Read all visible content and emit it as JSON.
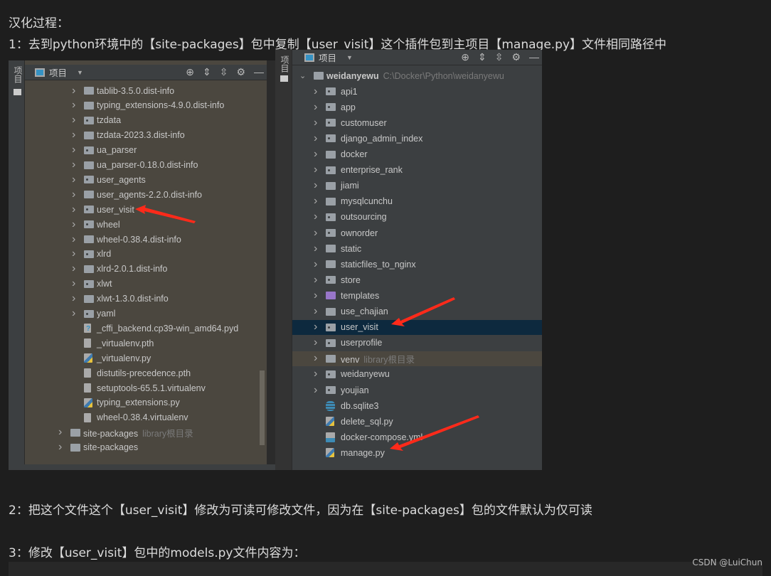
{
  "article": {
    "heading": "汉化过程：",
    "step1": "1：去到python环境中的【site-packages】包中复制【user_visit】这个插件包到主项目【manage.py】文件相同路径中",
    "step2": "2：把这个文件这个【user_visit】修改为可读可修改文件，因为在【site-packages】包的文件默认为仅可读",
    "step3": "3：修改【user_visit】包中的models.py文件内容为：",
    "watermark": "CSDN @LuiChun"
  },
  "left_shot": {
    "strip_label": "项目",
    "panel_title": "项目",
    "items": [
      {
        "label": "tablib-3.5.0.dist-info",
        "icon": "folder",
        "level": 2,
        "expand": true
      },
      {
        "label": "typing_extensions-4.9.0.dist-info",
        "icon": "folder",
        "level": 2,
        "expand": true
      },
      {
        "label": "tzdata",
        "icon": "pkg",
        "level": 2,
        "expand": true
      },
      {
        "label": "tzdata-2023.3.dist-info",
        "icon": "folder",
        "level": 2,
        "expand": true
      },
      {
        "label": "ua_parser",
        "icon": "pkg",
        "level": 2,
        "expand": true
      },
      {
        "label": "ua_parser-0.18.0.dist-info",
        "icon": "folder",
        "level": 2,
        "expand": true
      },
      {
        "label": "user_agents",
        "icon": "pkg",
        "level": 2,
        "expand": true
      },
      {
        "label": "user_agents-2.2.0.dist-info",
        "icon": "folder",
        "level": 2,
        "expand": true
      },
      {
        "label": "user_visit",
        "icon": "pkg",
        "level": 2,
        "expand": true
      },
      {
        "label": "wheel",
        "icon": "pkg",
        "level": 2,
        "expand": true
      },
      {
        "label": "wheel-0.38.4.dist-info",
        "icon": "folder",
        "level": 2,
        "expand": true
      },
      {
        "label": "xlrd",
        "icon": "pkg",
        "level": 2,
        "expand": true
      },
      {
        "label": "xlrd-2.0.1.dist-info",
        "icon": "folder",
        "level": 2,
        "expand": true
      },
      {
        "label": "xlwt",
        "icon": "pkg",
        "level": 2,
        "expand": true
      },
      {
        "label": "xlwt-1.3.0.dist-info",
        "icon": "folder",
        "level": 2,
        "expand": true
      },
      {
        "label": "yaml",
        "icon": "pkg",
        "level": 2,
        "expand": true
      },
      {
        "label": "_cffi_backend.cp39-win_amd64.pyd",
        "icon": "unk",
        "level": 2,
        "expand": false
      },
      {
        "label": "_virtualenv.pth",
        "icon": "file",
        "level": 2,
        "expand": false
      },
      {
        "label": "_virtualenv.py",
        "icon": "py",
        "level": 2,
        "expand": false
      },
      {
        "label": "distutils-precedence.pth",
        "icon": "file",
        "level": 2,
        "expand": false
      },
      {
        "label": "setuptools-65.5.1.virtualenv",
        "icon": "file",
        "level": 2,
        "expand": false
      },
      {
        "label": "typing_extensions.py",
        "icon": "py",
        "level": 2,
        "expand": false
      },
      {
        "label": "wheel-0.38.4.virtualenv",
        "icon": "file",
        "level": 2,
        "expand": false
      },
      {
        "label": "site-packages",
        "hint": "library根目录",
        "icon": "folder",
        "level": 1,
        "expand": true
      },
      {
        "label": "site-packages",
        "icon": "folder",
        "level": 1,
        "expand": true
      }
    ]
  },
  "right_shot": {
    "strip_label": "项目",
    "panel_title": "项目",
    "root": {
      "label": "weidanyewu",
      "path": "C:\\Docker\\Python\\weidanyewu"
    },
    "items": [
      {
        "label": "api1",
        "icon": "pkg",
        "expand": true
      },
      {
        "label": "app",
        "icon": "pkg",
        "expand": true
      },
      {
        "label": "customuser",
        "icon": "pkg",
        "expand": true
      },
      {
        "label": "django_admin_index",
        "icon": "pkg",
        "expand": true
      },
      {
        "label": "docker",
        "icon": "folder",
        "expand": true
      },
      {
        "label": "enterprise_rank",
        "icon": "pkg",
        "expand": true
      },
      {
        "label": "jiami",
        "icon": "folder",
        "expand": true
      },
      {
        "label": "mysqlcunchu",
        "icon": "folder",
        "expand": true
      },
      {
        "label": "outsourcing",
        "icon": "pkg",
        "expand": true
      },
      {
        "label": "ownorder",
        "icon": "pkg",
        "expand": true
      },
      {
        "label": "static",
        "icon": "folder",
        "expand": true
      },
      {
        "label": "staticfiles_to_nginx",
        "icon": "folder",
        "expand": true
      },
      {
        "label": "store",
        "icon": "pkg",
        "expand": true
      },
      {
        "label": "templates",
        "icon": "purple",
        "expand": true
      },
      {
        "label": "use_chajian",
        "icon": "folder",
        "expand": true
      },
      {
        "label": "user_visit",
        "icon": "pkg",
        "expand": true,
        "selected": true
      },
      {
        "label": "userprofile",
        "icon": "pkg",
        "expand": true
      },
      {
        "label": "venv",
        "hint": "library根目录",
        "icon": "folder",
        "expand": true,
        "library": true
      },
      {
        "label": "weidanyewu",
        "icon": "pkg",
        "expand": true
      },
      {
        "label": "youjian",
        "icon": "pkg",
        "expand": true
      },
      {
        "label": "db.sqlite3",
        "icon": "db",
        "expand": false
      },
      {
        "label": "delete_sql.py",
        "icon": "py",
        "expand": false
      },
      {
        "label": "docker-compose.yml",
        "icon": "dc",
        "expand": false
      },
      {
        "label": "manage.py",
        "icon": "py",
        "expand": false
      }
    ]
  },
  "colors": {
    "page_bg": "#1e1e1e",
    "left_panel_bg": "#4b473f",
    "right_panel_bg": "#3c3f41",
    "selection": "#0d293e",
    "arrow": "#ff2a1a"
  }
}
